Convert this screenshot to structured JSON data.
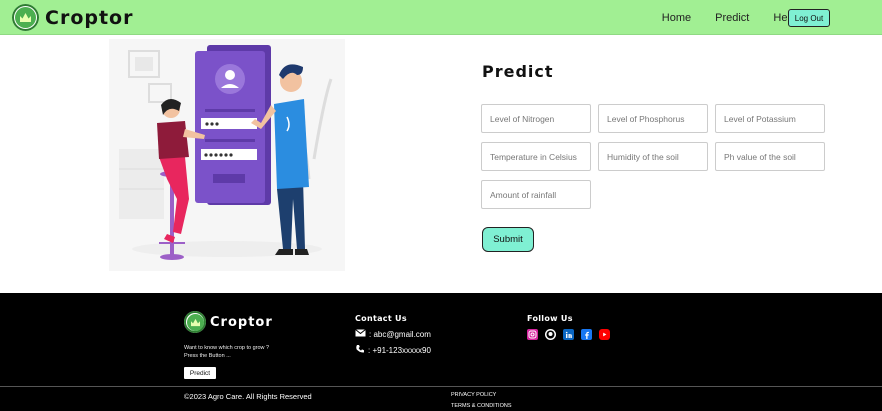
{
  "brand": {
    "name": "Croptor"
  },
  "nav": {
    "items": [
      "Home",
      "Predict",
      "Help"
    ],
    "logout": "Log Out"
  },
  "form": {
    "title": "Predict",
    "fields": [
      {
        "placeholder": "Level of Nitrogen"
      },
      {
        "placeholder": "Level of Phosphorus"
      },
      {
        "placeholder": "Level of Potassium"
      },
      {
        "placeholder": "Temperature in Celsius"
      },
      {
        "placeholder": "Humidity of the soil"
      },
      {
        "placeholder": "Ph value of the soil"
      },
      {
        "placeholder": "Amount of rainfall"
      }
    ],
    "submit": "Submit"
  },
  "footer": {
    "brand": "Croptor",
    "tagline_1": "Want to know which crop to grow ?",
    "tagline_2": "Press the Button ...",
    "predict_button": "Predict",
    "contact_heading": "Contact Us",
    "email": ": abc@gmail.com",
    "phone": ": +91-123xxxxx90",
    "follow_heading": "Follow Us",
    "socials": [
      "instagram-icon",
      "github-icon",
      "linkedin-icon",
      "facebook-icon",
      "youtube-icon"
    ],
    "copyright": "©2023 Agro Care. All Rights Reserved",
    "privacy": "PRIVACY POLICY",
    "terms": "TERMS & CONDITIONS"
  },
  "colors": {
    "navbar": "#a1ef93",
    "accent_button": "#7ff0d3",
    "footer": "#000000",
    "illustration_purple": "#7b52c9"
  }
}
